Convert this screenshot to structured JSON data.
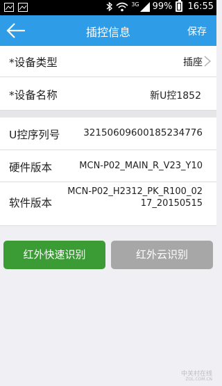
{
  "status_bar": {
    "signal_label": "3G",
    "battery_percent": "99%",
    "time": "16:55",
    "icons": [
      "image-icon",
      "image-icon",
      "bluetooth-icon",
      "wifi-icon",
      "signal-icon",
      "battery-icon"
    ]
  },
  "header": {
    "title": "插控信息",
    "save_label": "保存",
    "back_icon": "back-arrow-icon"
  },
  "device_info": {
    "type_label": "*设备类型",
    "type_value": "插座",
    "name_label": "*设备名称",
    "name_value": "新U控1852"
  },
  "details": {
    "serial_label": "U控序列号",
    "serial_value": "32150609600185234776",
    "hardware_label": "硬件版本",
    "hardware_value": "MCN-P02_MAIN_R_V23_Y10",
    "software_label": "软件版本",
    "software_value": "MCN-P02_H2312_PK_R100_0217_20150515"
  },
  "actions": {
    "quick_ir_label": "红外快速识别",
    "cloud_ir_label": "红外云识别"
  },
  "watermark": {
    "main": "中关村在线",
    "sub": "ZOL.COM.CN"
  },
  "colors": {
    "app_bar": "#2f9ce8",
    "quick_button": "#3b9b34",
    "cloud_button": "#a7a7a7"
  }
}
